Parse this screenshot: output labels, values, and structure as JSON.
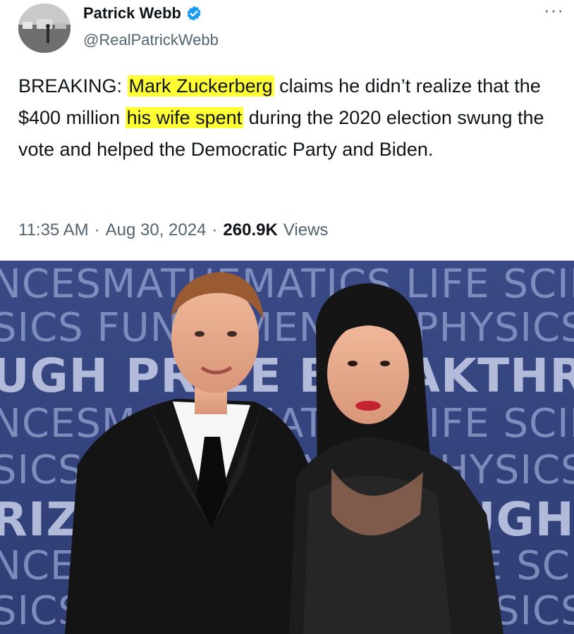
{
  "author": {
    "name": "Patrick Webb",
    "handle": "@RealPatrickWebb",
    "verified_icon": "verified-badge-icon",
    "more_icon": "more-options-icon"
  },
  "tweet": {
    "seg1": "BREAKING: ",
    "hl1": "Mark Zuckerberg",
    "seg2": " claims he didn’t realize that the $400 million ",
    "hl2": "his wife spent",
    "seg3": " during the 2020 election swung the vote and helped the Democratic Party and Biden."
  },
  "meta": {
    "time": "11:35 AM",
    "sep1": "·",
    "date": "Aug 30, 2024",
    "sep2": "·",
    "views_count": "260.9K",
    "views_label": "Views"
  },
  "photo": {
    "backdrop_lines": [
      "NCESMATHEMATICS LIFE SCIENCES",
      "SICS FUNDAMENTAL PHYSICS",
      "UGH PRIZE BREAKTHROUGH",
      "NCESMATHEMATICS LIFE SCIENCES",
      "SICS FUNDAMENTAL PHYSICS",
      "RIZE BREAKTHROUGH PRIZE",
      "NCES MATHEMATICS LIFE SCIENCES",
      "SICS FUNDAMENTAL PHYSICS"
    ]
  },
  "colors": {
    "highlight": "#ffff33",
    "verified": "#1d9bf0",
    "backdrop": "#3c4d8c"
  }
}
